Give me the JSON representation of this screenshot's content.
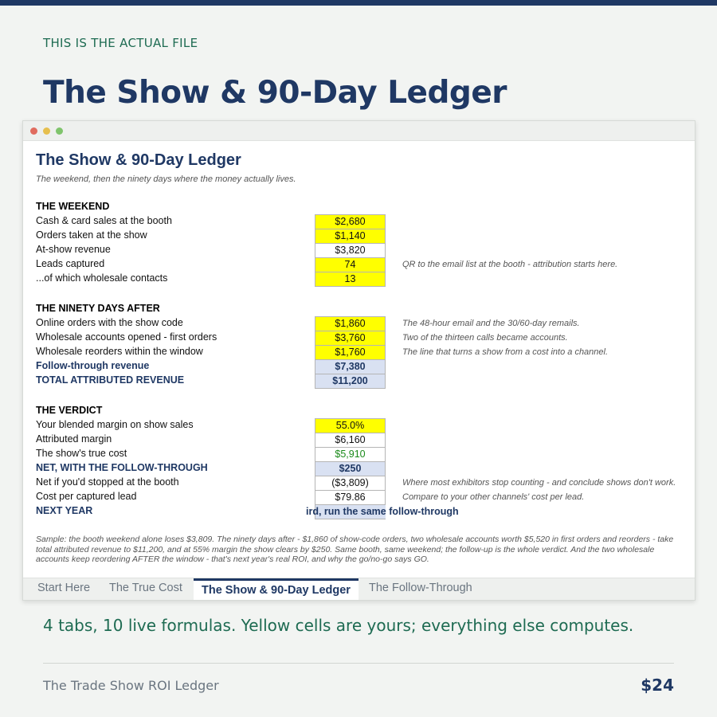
{
  "eyebrow": "THIS IS THE ACTUAL FILE",
  "headline": "The Show & 90-Day Ledger",
  "window": {
    "dots": [
      "red",
      "yellow",
      "green"
    ]
  },
  "sheet": {
    "title": "The Show & 90-Day Ledger",
    "subtitle": "The weekend, then the ninety days where the money actually lives.",
    "sections": {
      "weekend": "THE WEEKEND",
      "ninety": "THE NINETY DAYS AFTER",
      "verdict": "THE VERDICT"
    },
    "rows": {
      "cash_sales": {
        "label": "Cash & card sales at the booth",
        "value": "$2,680",
        "note": ""
      },
      "orders_taken": {
        "label": "Orders taken at the show",
        "value": "$1,140",
        "note": ""
      },
      "at_show_revenue": {
        "label": "At-show revenue",
        "value": "$3,820",
        "note": ""
      },
      "leads": {
        "label": "Leads captured",
        "value": "74",
        "note": "QR to the email list at the booth - attribution starts here."
      },
      "wholesale_contacts": {
        "label": "...of which wholesale contacts",
        "value": "13",
        "note": ""
      },
      "online_orders": {
        "label": "Online orders with the show code",
        "value": "$1,860",
        "note": "The 48-hour email and the 30/60-day remails."
      },
      "wholesale_opened": {
        "label": "Wholesale accounts opened - first orders",
        "value": "$3,760",
        "note": "Two of the thirteen calls became accounts."
      },
      "wholesale_reorders": {
        "label": "Wholesale reorders within the window",
        "value": "$1,760",
        "note": "The line that turns a show from a cost into a channel."
      },
      "follow_through": {
        "label": "Follow-through revenue",
        "value": "$7,380",
        "note": ""
      },
      "total_attributed": {
        "label": "TOTAL ATTRIBUTED REVENUE",
        "value": "$11,200",
        "note": ""
      },
      "blended_margin": {
        "label": "Your blended margin on show sales",
        "value": "55.0%",
        "note": ""
      },
      "attributed_margin": {
        "label": "Attributed margin",
        "value": "$6,160",
        "note": ""
      },
      "true_cost": {
        "label": "The show's true cost",
        "value": "$5,910",
        "note": ""
      },
      "net_follow": {
        "label": "NET, WITH THE FOLLOW-THROUGH",
        "value": "$250",
        "note": ""
      },
      "net_stopped": {
        "label": "Net if you'd stopped at the booth",
        "value": "($3,809)",
        "note": "Where most exhibitors stop counting - and conclude shows don't work."
      },
      "cost_per_lead": {
        "label": "Cost per captured lead",
        "value": "$79.86",
        "note": "Compare to your other channels' cost per lead."
      },
      "next_year": {
        "label": "NEXT YEAR",
        "value": "ird, run the same follow-through",
        "note": ""
      }
    },
    "footnote": "Sample: the booth weekend alone loses $3,809. The ninety days after - $1,860 of show-code orders, two wholesale accounts worth $5,520 in first orders and reorders - take total attributed revenue to $11,200, and at 55% margin the show clears by $250. Same booth, same weekend; the follow-up is the whole verdict. And the two wholesale accounts keep reordering AFTER the window - that's next year's real ROI, and why the go/no-go says GO.",
    "tabs": [
      "Start Here",
      "The True Cost",
      "The Show & 90-Day Ledger",
      "The Follow-Through"
    ],
    "active_tab": "The Show & 90-Day Ledger",
    "colors": {
      "input": "#ffff00",
      "calc": "#d9e1f2",
      "navy": "#1f3864"
    }
  },
  "tagline": "4 tabs, 10 live formulas. Yellow cells are yours; everything else computes.",
  "product_name": "The Trade Show ROI Ledger",
  "price": "$24"
}
